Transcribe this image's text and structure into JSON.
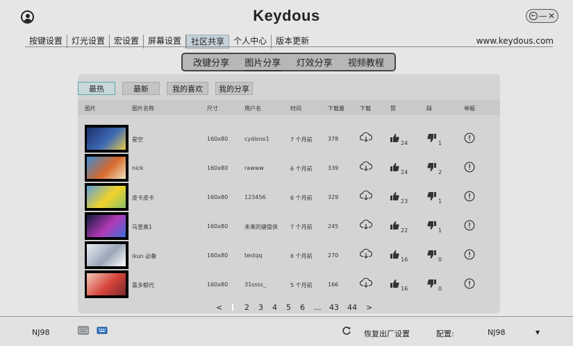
{
  "app": {
    "title": "Keydous"
  },
  "window": {
    "back": "←",
    "minimize": "—",
    "close": "✕"
  },
  "nav": {
    "items": [
      {
        "label": "按键设置",
        "active": false
      },
      {
        "label": "灯光设置",
        "active": false
      },
      {
        "label": "宏设置",
        "active": false
      },
      {
        "label": "屏幕设置",
        "active": false
      },
      {
        "label": "社区共享",
        "active": true
      },
      {
        "label": "个人中心",
        "active": false
      },
      {
        "label": "版本更新",
        "active": false
      }
    ],
    "site": "www.keydous.com"
  },
  "subtabs": [
    {
      "label": "改键分享",
      "active": false
    },
    {
      "label": "图片分享",
      "active": true
    },
    {
      "label": "灯效分享",
      "active": false
    },
    {
      "label": "视频教程",
      "active": false
    }
  ],
  "filters": [
    {
      "label": "最热",
      "active": true
    },
    {
      "label": "最新",
      "active": false
    },
    {
      "label": "我的喜欢",
      "active": false
    },
    {
      "label": "我的分享",
      "active": false
    }
  ],
  "table": {
    "headers": {
      "image": "图片",
      "name": "图片名称",
      "size": "尺寸",
      "user": "用户名",
      "time": "时间",
      "downloads": "下载量",
      "download": "下载",
      "like": "赞",
      "dislike": "踩",
      "report": "举报"
    },
    "rows": [
      {
        "name": "星空",
        "size": "160x80",
        "user": "cydisno1",
        "time": "7 个月前",
        "downloads": "378",
        "likes": "24",
        "dislikes": "1",
        "thumb_colors": [
          "#1b2e6b",
          "#3d6bb5",
          "#e8c64a"
        ]
      },
      {
        "name": "nick",
        "size": "160x80",
        "user": "rawww",
        "time": "6 个月前",
        "downloads": "339",
        "likes": "24",
        "dislikes": "2",
        "thumb_colors": [
          "#3a8bd6",
          "#d7692a",
          "#f2e2c0"
        ]
      },
      {
        "name": "皮卡皮卡",
        "size": "160x80",
        "user": "123456",
        "time": "6 个月前",
        "downloads": "329",
        "likes": "23",
        "dislikes": "1",
        "thumb_colors": [
          "#5fa1d8",
          "#f3d22b",
          "#8ac06a"
        ]
      },
      {
        "name": "马里奥1",
        "size": "160x80",
        "user": "未来的键盘侠",
        "time": "7 个月前",
        "downloads": "245",
        "likes": "22",
        "dislikes": "1",
        "thumb_colors": [
          "#151a3a",
          "#b23ab8",
          "#3a6fd8"
        ]
      },
      {
        "name": "ikun 必备",
        "size": "160x80",
        "user": "testqq",
        "time": "6 个月前",
        "downloads": "270",
        "likes": "16",
        "dislikes": "0",
        "thumb_colors": [
          "#e8ecf2",
          "#9aa6b8",
          "#ffffff"
        ]
      },
      {
        "name": "喜多郁代",
        "size": "160x80",
        "user": "31ssss_",
        "time": "5 个月前",
        "downloads": "166",
        "likes": "16",
        "dislikes": "0",
        "thumb_colors": [
          "#f2c9b8",
          "#d6443a",
          "#7a2a2a"
        ]
      }
    ]
  },
  "pager": {
    "prev": "<",
    "pages": [
      "2",
      "3",
      "4",
      "5",
      "6"
    ],
    "ellipsis": "...",
    "tail": [
      "43",
      "44"
    ],
    "next": ">"
  },
  "bottom": {
    "device": "NJ98",
    "reset": "恢复出厂设置",
    "config_label": "配置:",
    "config_value": "NJ98",
    "dropdown": "▼"
  }
}
